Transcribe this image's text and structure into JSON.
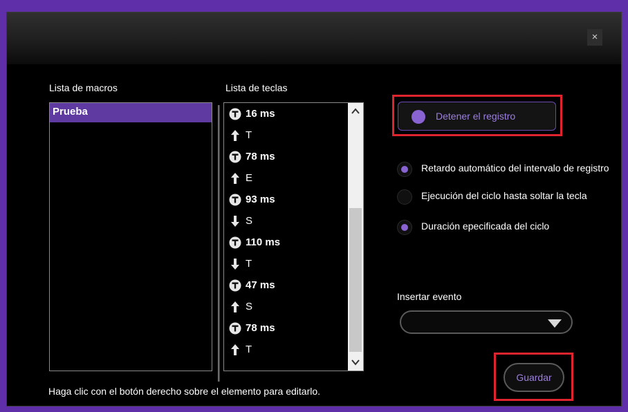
{
  "window": {
    "close_label": "×"
  },
  "macros": {
    "header": "Lista de macros",
    "items": [
      "Prueba"
    ]
  },
  "keys": {
    "header": "Lista de teclas",
    "rows": [
      {
        "icon": "timer-icon",
        "text": "16 ms",
        "type": "delay"
      },
      {
        "icon": "arrow-up-icon",
        "text": "T",
        "type": "up"
      },
      {
        "icon": "timer-icon",
        "text": "78 ms",
        "type": "delay"
      },
      {
        "icon": "arrow-up-icon",
        "text": "E",
        "type": "up"
      },
      {
        "icon": "timer-icon",
        "text": "93 ms",
        "type": "delay"
      },
      {
        "icon": "arrow-down-icon",
        "text": "S",
        "type": "down"
      },
      {
        "icon": "timer-icon",
        "text": "110 ms",
        "type": "delay"
      },
      {
        "icon": "arrow-down-icon",
        "text": "T",
        "type": "down"
      },
      {
        "icon": "timer-icon",
        "text": "47 ms",
        "type": "delay"
      },
      {
        "icon": "arrow-up-icon",
        "text": "S",
        "type": "up"
      },
      {
        "icon": "timer-icon",
        "text": "78 ms",
        "type": "delay"
      },
      {
        "icon": "arrow-up-icon",
        "text": "T",
        "type": "up"
      }
    ]
  },
  "record": {
    "label": "Detener el registro"
  },
  "options": [
    {
      "label": "Retardo automático del intervalo de registro",
      "selected": true
    },
    {
      "label": "Ejecución del ciclo hasta soltar la tecla",
      "selected": false
    },
    {
      "label": "Duración epecificada del ciclo",
      "selected": true
    }
  ],
  "insert_event": {
    "label": "Insertar evento",
    "value": ""
  },
  "save": {
    "label": "Guardar"
  },
  "hint": "Haga clic con el botón derecho sobre el elemento para editarlo.",
  "colors": {
    "accent": "#8a63d2",
    "selection": "#5f3aa1",
    "highlight": "#e0242e",
    "background": "#5e2fa8"
  }
}
